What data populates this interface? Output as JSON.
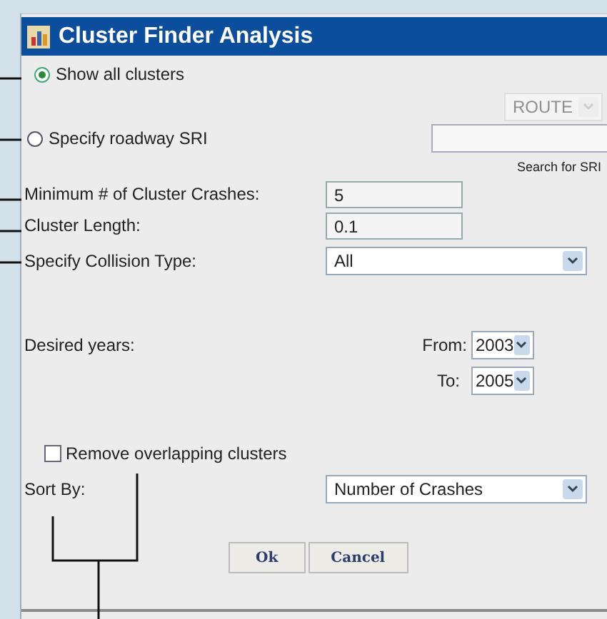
{
  "window": {
    "title": "Cluster Finder Analysis"
  },
  "options": [
    {
      "label": "Show all clusters",
      "selected": true
    },
    {
      "label": "Specify roadway SRI",
      "selected": false
    }
  ],
  "route_select": {
    "value": "ROUTE",
    "disabled": true
  },
  "sri_search": {
    "caption": "Search for SRI"
  },
  "fields": [
    {
      "kind": "text",
      "label": "Minimum # of Cluster Crashes:",
      "value": "5"
    },
    {
      "kind": "text",
      "label": "Cluster Length:",
      "value": "0.1"
    },
    {
      "kind": "select",
      "label": "Specify Collision Type:",
      "value": "All"
    }
  ],
  "years": {
    "label": "Desired years:",
    "from": {
      "label": "From:",
      "value": "2003"
    },
    "to": {
      "label": "To:",
      "value": "2005"
    }
  },
  "remove_overlapping": {
    "label": "Remove overlapping clusters",
    "checked": false
  },
  "sort_by": {
    "label": "Sort By:",
    "value": "Number of Crashes"
  },
  "buttons": [
    "Ok",
    "Cancel"
  ]
}
